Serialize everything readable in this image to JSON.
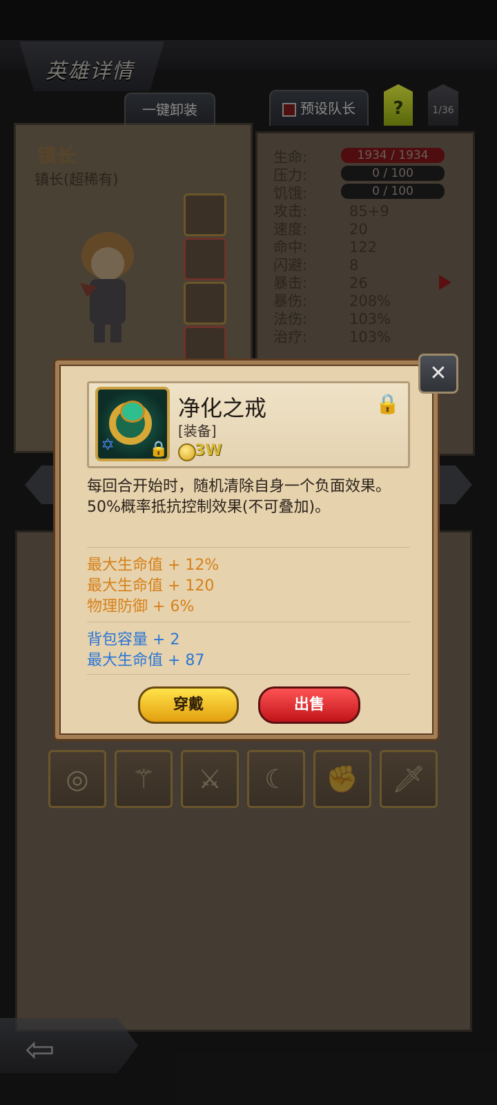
{
  "header": {
    "title": "英雄详情",
    "unequip_all": "一键卸装",
    "preset_leader": "预设队长",
    "help": "?",
    "page_count": "1/36"
  },
  "hero": {
    "name": "镇长",
    "class": "镇长(超稀有)"
  },
  "stats": [
    {
      "label": "生命:",
      "value": "1934 / 1934"
    },
    {
      "label": "压力:",
      "value": "0 / 100"
    },
    {
      "label": "饥饿:",
      "value": "0 / 100"
    },
    {
      "label": "攻击:",
      "value": "85+9"
    },
    {
      "label": "速度:",
      "value": "20"
    },
    {
      "label": "命中:",
      "value": "122"
    },
    {
      "label": "闪避:",
      "value": "8"
    },
    {
      "label": "暴击:",
      "value": "26"
    },
    {
      "label": "暴伤:",
      "value": "208%"
    },
    {
      "label": "法伤:",
      "value": "103%"
    },
    {
      "label": "治疗:",
      "value": "103%"
    }
  ],
  "item": {
    "name": "净化之戒",
    "type": "[装备]",
    "price": "3W",
    "description_line1": "每回合开始时，随机清除自身一个负面效果。",
    "description_line2": "50%概率抵抗控制效果(不可叠加)。",
    "main_stats": [
      "最大生命值 + 12%",
      "最大生命值 + 120",
      "物理防御 + 6%"
    ],
    "extra_stats": [
      "背包容量 + 2",
      "最大生命值 + 87"
    ]
  },
  "actions": {
    "equip": "穿戴",
    "sell": "出售"
  },
  "icons": {
    "close": "close-swords-icon",
    "lock": "lock-icon",
    "coin": "gold-coin-icon",
    "back": "back-arrow-icon"
  },
  "colors": {
    "orange_stat": "#d6801a",
    "blue_stat": "#2b76d7",
    "equip_button": "#f5c21f",
    "sell_button": "#e0262b"
  }
}
